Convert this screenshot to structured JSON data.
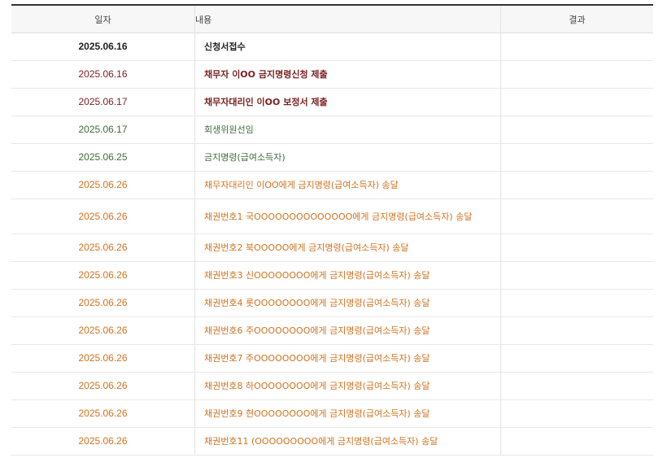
{
  "table": {
    "headers": {
      "date": "일자",
      "content": "내용",
      "result": "결과"
    },
    "colors": {
      "black": "#222222",
      "maroon": "#7a1f1f",
      "green": "#3e6d3a",
      "orange": "#d1731f"
    },
    "rows": [
      {
        "date": "2025.06.16",
        "content": "신청서접수",
        "result": ""
      },
      {
        "date": "2025.06.16",
        "content": "채무자 이OO 금지명령신청 제출",
        "result": ""
      },
      {
        "date": "2025.06.17",
        "content": "채무자대리인 이OO 보정서 제출",
        "result": ""
      },
      {
        "date": "2025.06.17",
        "content": "회생위원선임",
        "result": ""
      },
      {
        "date": "2025.06.25",
        "content": "금지명령(급여소득자)",
        "result": ""
      },
      {
        "date": "2025.06.26",
        "content": "채무자대리인 이OO에게 금지명령(급여소득자) 송달",
        "result": ""
      },
      {
        "date": "2025.06.26",
        "content": "채권번호1 국OOOOOOOOOOOOOO에게 금지명령(급여소득자) 송달",
        "result": ""
      },
      {
        "date": "2025.06.26",
        "content": "채권번호2 북OOOOO에게 금지명령(급여소득자) 송달",
        "result": ""
      },
      {
        "date": "2025.06.26",
        "content": "채권번호3 신OOOOOOOO에게 금지명령(급여소득자) 송달",
        "result": ""
      },
      {
        "date": "2025.06.26",
        "content": "채권번호4 롯OOOOOOOO에게 금지명령(급여소득자) 송달",
        "result": ""
      },
      {
        "date": "2025.06.26",
        "content": "채권번호6 주OOOOOOOO에게 금지명령(급여소득자) 송달",
        "result": ""
      },
      {
        "date": "2025.06.26",
        "content": "채권번호7 주OOOOOOOO에게 금지명령(급여소득자) 송달",
        "result": ""
      },
      {
        "date": "2025.06.26",
        "content": "채권번호8 하OOOOOOOO에게 금지명령(급여소득자) 송달",
        "result": ""
      },
      {
        "date": "2025.06.26",
        "content": "채권번호9 현OOOOOOOO에게 금지명령(급여소득자) 송달",
        "result": ""
      },
      {
        "date": "2025.06.26",
        "content": "채권번호11 (OOOOOOOOO에게 금지명령(급여소득자) 송달",
        "result": ""
      }
    ]
  }
}
